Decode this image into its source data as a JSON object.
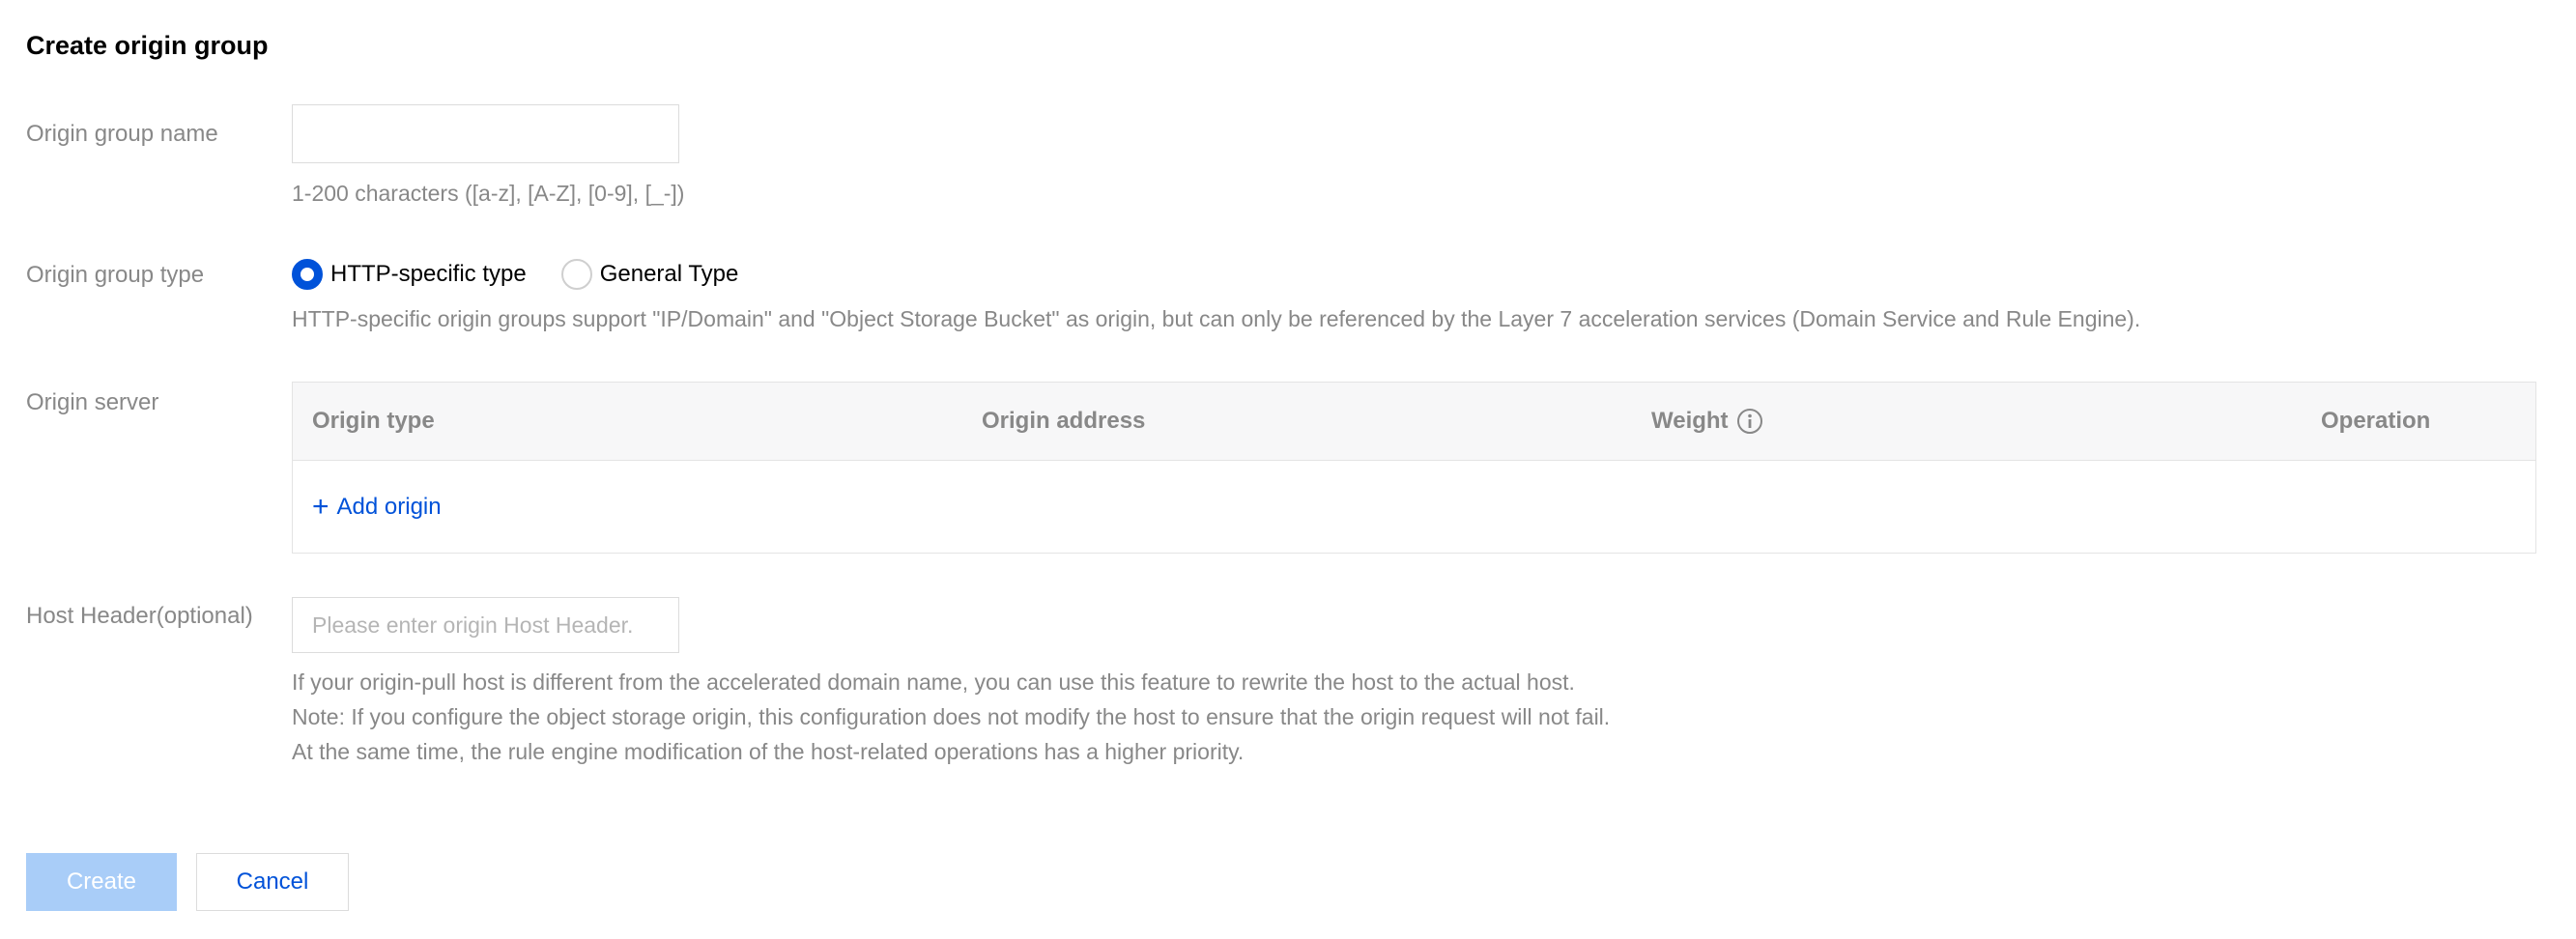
{
  "page": {
    "title": "Create origin group"
  },
  "form": {
    "name": {
      "label": "Origin group name",
      "value": "",
      "hint": "1-200 characters ([a-z], [A-Z], [0-9], [_-])"
    },
    "type": {
      "label": "Origin group type",
      "options": [
        {
          "label": "HTTP-specific type",
          "checked": true
        },
        {
          "label": "General Type",
          "checked": false
        }
      ],
      "hint": "HTTP-specific origin groups support \"IP/Domain\" and \"Object Storage Bucket\" as origin, but can only be referenced by the Layer 7 acceleration services (Domain Service and Rule Engine)."
    },
    "server": {
      "label": "Origin server",
      "columns": [
        "Origin type",
        "Origin address",
        "Weight",
        "Operation"
      ],
      "add_label": "Add origin"
    },
    "host": {
      "label": "Host Header(optional)",
      "placeholder": "Please enter origin Host Header.",
      "value": "",
      "hints": [
        "If your origin-pull host is different from the accelerated domain name, you can use this feature to rewrite the host to the actual host.",
        "Note: If you configure the object storage origin, this configuration does not modify the host to ensure that the origin request will not fail.",
        "At the same time, the rule engine modification of the host-related operations has a higher priority."
      ]
    }
  },
  "actions": {
    "create_label": "Create",
    "cancel_label": "Cancel"
  },
  "colors": {
    "accent": "#0052d9",
    "primary_disabled": "#a9cdf8",
    "muted_text": "#888888"
  },
  "icons": {
    "weight_info": "info-circle-icon",
    "add": "plus-icon"
  }
}
